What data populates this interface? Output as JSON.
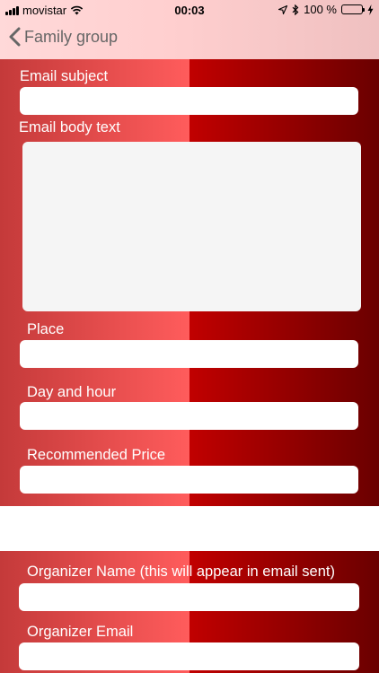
{
  "status_bar": {
    "carrier": "movistar",
    "time": "00:03",
    "battery_percent": "100 %",
    "battery_color": "#2ecc40"
  },
  "nav": {
    "back_label": "Family group",
    "back_icon": "chevron-left-icon"
  },
  "form": {
    "email_subject": {
      "label": "Email subject",
      "value": ""
    },
    "email_body": {
      "label": "Email body text",
      "value": ""
    },
    "place": {
      "label": "Place",
      "value": ""
    },
    "day_hour": {
      "label": "Day and hour",
      "value": ""
    },
    "recommended_price": {
      "label": "Recommended Price",
      "value": ""
    },
    "organizer_name": {
      "label": "Organizer Name (this will appear in email sent)",
      "value": ""
    },
    "organizer_email": {
      "label": "Organizer Email",
      "value": ""
    }
  },
  "colors": {
    "panel_left": "#c43a3a",
    "panel_mid_light": "#ff5c5c",
    "panel_mid_dark": "#c10000",
    "panel_right": "#6a0000",
    "topbar": "#ffd9d9"
  }
}
